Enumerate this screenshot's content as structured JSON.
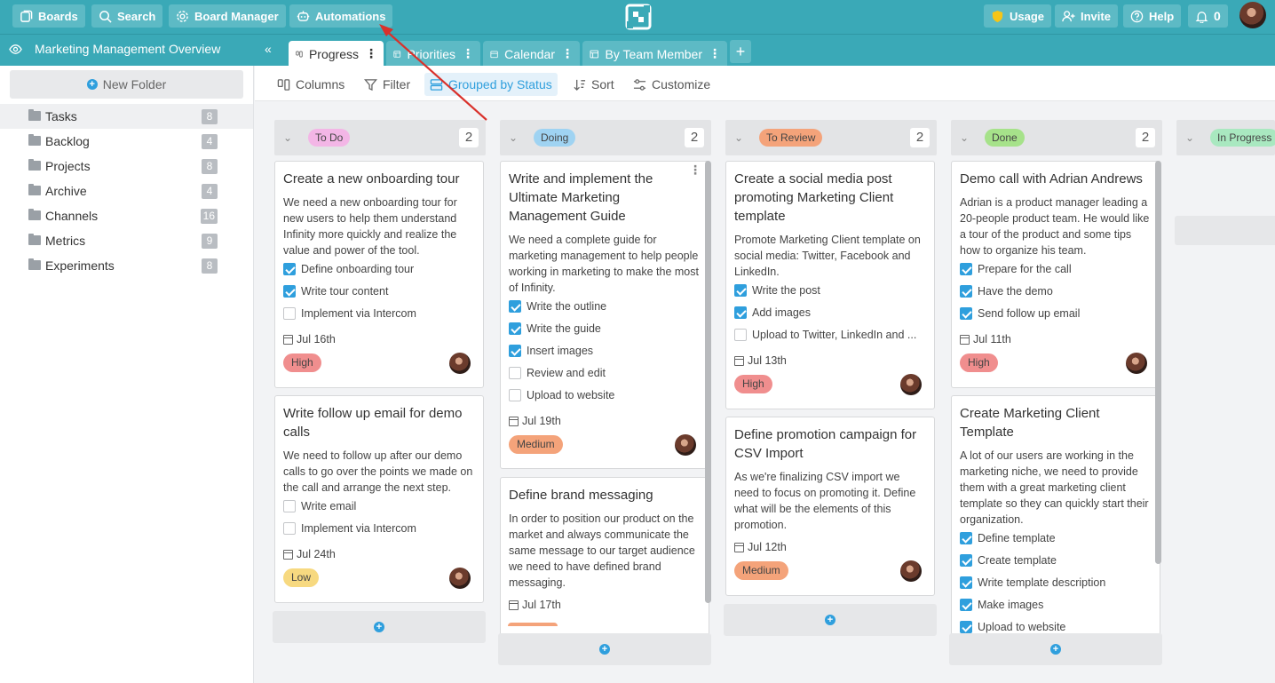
{
  "topbar": {
    "boards": "Boards",
    "search": "Search",
    "board_manager": "Board Manager",
    "automations": "Automations",
    "usage": "Usage",
    "invite": "Invite",
    "help": "Help",
    "notifications_count": "0"
  },
  "tabbar": {
    "board_title": "Marketing Management Overview",
    "tabs": [
      {
        "label": "Progress"
      },
      {
        "label": "Priorities"
      },
      {
        "label": "Calendar"
      },
      {
        "label": "By Team Member"
      }
    ],
    "add_tab": "+"
  },
  "sidebar": {
    "new_folder": "New Folder",
    "folders": [
      {
        "label": "Tasks",
        "count": "8"
      },
      {
        "label": "Backlog",
        "count": "4"
      },
      {
        "label": "Projects",
        "count": "8"
      },
      {
        "label": "Archive",
        "count": "4"
      },
      {
        "label": "Channels",
        "count": "16"
      },
      {
        "label": "Metrics",
        "count": "9"
      },
      {
        "label": "Experiments",
        "count": "8"
      }
    ]
  },
  "toolbar": {
    "columns": "Columns",
    "filter": "Filter",
    "grouped": "Grouped by Status",
    "sort": "Sort",
    "customize": "Customize"
  },
  "columns": [
    {
      "status": "To Do",
      "color": "#f3b6e6",
      "count": "2",
      "cards": [
        {
          "title": "Create a new onboarding tour",
          "desc": "We need a new onboarding tour for new users to help them understand Infinity more quickly and realize the value and power of the tool.",
          "checks": [
            {
              "label": "Define onboarding tour",
              "done": true
            },
            {
              "label": "Write tour content",
              "done": true
            },
            {
              "label": "Implement via Intercom",
              "done": false
            }
          ],
          "date": "Jul 16th",
          "priority": "High"
        },
        {
          "title": "Write follow up email for demo calls",
          "desc": "We need to follow up after our demo calls to go over the points we made on the call and arrange the next step.",
          "checks": [
            {
              "label": "Write email",
              "done": false
            },
            {
              "label": "Implement via Intercom",
              "done": false
            }
          ],
          "date": "Jul 24th",
          "priority": "Low"
        }
      ]
    },
    {
      "status": "Doing",
      "color": "#9fd3f2",
      "count": "2",
      "cards": [
        {
          "title": "Write and implement the Ultimate Marketing Management Guide",
          "desc": "We need a complete guide for marketing management to help people working in marketing to make the most of Infinity.",
          "checks": [
            {
              "label": "Write the outline",
              "done": true
            },
            {
              "label": "Write the guide",
              "done": true
            },
            {
              "label": "Insert images",
              "done": true
            },
            {
              "label": "Review and edit",
              "done": false
            },
            {
              "label": "Upload to website",
              "done": false
            }
          ],
          "date": "Jul 19th",
          "priority": "Medium"
        },
        {
          "title": "Define brand messaging",
          "desc": "In order to position our product on the market and always communicate the same message to our target audience we need to have defined brand messaging.",
          "checks": [],
          "date": "Jul 17th",
          "priority": ""
        }
      ]
    },
    {
      "status": "To Review",
      "color": "#f4a37a",
      "count": "2",
      "cards": [
        {
          "title": "Create a social media post promoting Marketing Client template",
          "desc": "Promote Marketing Client template on social media: Twitter, Facebook and LinkedIn.",
          "checks": [
            {
              "label": "Write the post",
              "done": true
            },
            {
              "label": "Add images",
              "done": true
            },
            {
              "label": "Upload to Twitter, LinkedIn and ...",
              "done": false
            }
          ],
          "date": "Jul 13th",
          "priority": "High"
        },
        {
          "title": "Define promotion campaign for CSV Import",
          "desc": "As we're finalizing CSV import we need to focus on promoting it. Define what will be the elements of this promotion.",
          "checks": [],
          "date": "Jul 12th",
          "priority": "Medium"
        }
      ]
    },
    {
      "status": "Done",
      "color": "#a6e28a",
      "count": "2",
      "cards": [
        {
          "title": "Demo call with Adrian Andrews",
          "desc": "Adrian is a product manager leading a 20-people product team. He would like a tour of the product and some tips how to organize his team.",
          "checks": [
            {
              "label": "Prepare for the call",
              "done": true
            },
            {
              "label": "Have the demo",
              "done": true
            },
            {
              "label": "Send follow up email",
              "done": true
            }
          ],
          "date": "Jul 11th",
          "priority": "High"
        },
        {
          "title": "Create Marketing Client Template",
          "desc": "A lot of our users are working in the marketing niche, we need to provide them with a great marketing client template so they can quickly start their organization.",
          "checks": [
            {
              "label": "Define template",
              "done": true
            },
            {
              "label": "Create template",
              "done": true
            },
            {
              "label": "Write template description",
              "done": true
            },
            {
              "label": "Make images",
              "done": true
            },
            {
              "label": "Upload to website",
              "done": true
            }
          ],
          "date": "",
          "priority": ""
        }
      ]
    },
    {
      "status": "In Progress",
      "color": "#a9e8c0",
      "count": "",
      "cards": []
    }
  ],
  "colors": {
    "brand": "#3aa9b7",
    "accent": "#2f9fdd",
    "high": "#f08e8e",
    "medium": "#f4a37a",
    "low": "#f7d980",
    "annotation_arrow": "#d9312b"
  }
}
